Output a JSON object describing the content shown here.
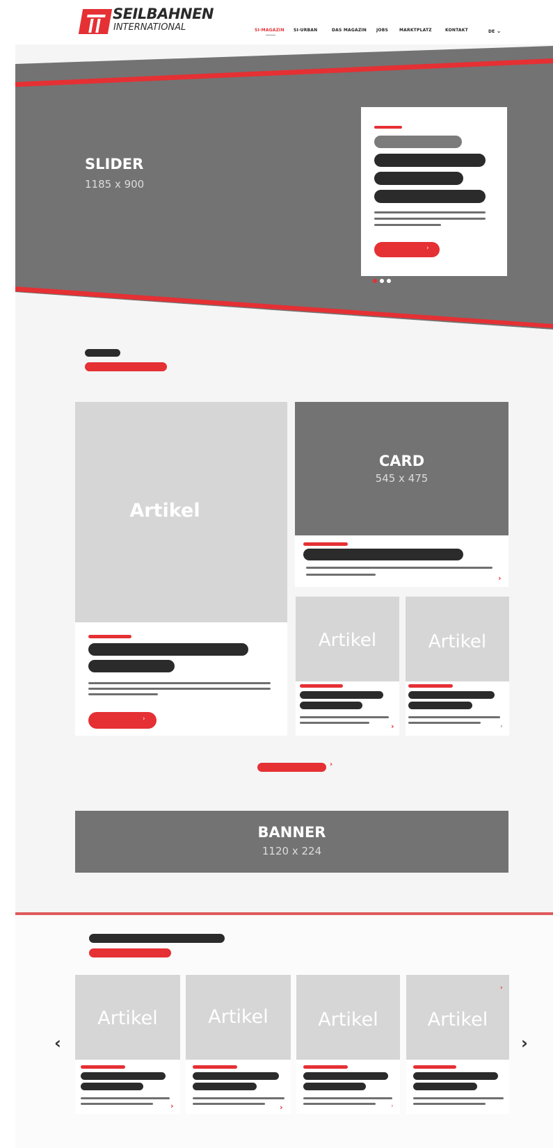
{
  "header": {
    "logo_line1": "SEILBAHNEN",
    "logo_line2": "INTERNATIONAL",
    "nav": [
      "SI-MAGAZIN",
      "SI-URBAN",
      "DAS MAGAZIN",
      "JOBS",
      "MARKTPLATZ",
      "KONTAKT"
    ],
    "lang": "DE",
    "active_nav_color": "#e53034"
  },
  "hero": {
    "title": "SLIDER",
    "size": "1185 x 900"
  },
  "grid": {
    "big_article_label": "Artikel",
    "card_title": "CARD",
    "card_size": "545 x 475",
    "small_article_labels": [
      "Artikel",
      "Artikel"
    ]
  },
  "banner": {
    "title": "BANNER",
    "size": "1120 x 224"
  },
  "carousel": {
    "labels": [
      "Artikel",
      "Artikel",
      "Artikel",
      "Artikel"
    ],
    "prev": "‹",
    "next": "›"
  },
  "colors": {
    "accent": "#e53034",
    "placeholder_dark": "#737373",
    "placeholder_light": "#d6d6d6",
    "page_bg": "#f5f5f5"
  }
}
